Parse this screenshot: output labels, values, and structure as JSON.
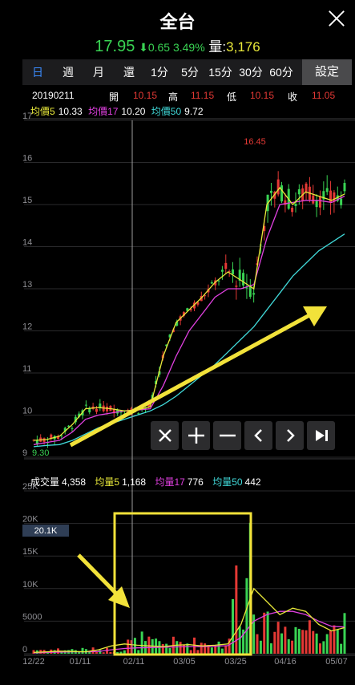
{
  "header": {
    "title": "全台"
  },
  "quote": {
    "price": "17.95",
    "change": "0.65 3.49%",
    "volume_label": "量:",
    "volume": "3,176"
  },
  "tabs": [
    {
      "label": "日",
      "active": true
    },
    {
      "label": "週"
    },
    {
      "label": "月"
    },
    {
      "label": "還"
    },
    {
      "label": "1分"
    },
    {
      "label": "5分"
    },
    {
      "label": "15分"
    },
    {
      "label": "30分"
    },
    {
      "label": "60分"
    }
  ],
  "settings_label": "設定",
  "ohlc": {
    "date": "20190211",
    "open_label": "開",
    "open": "10.15",
    "high_label": "高",
    "high": "11.15",
    "low_label": "低",
    "low": "10.15",
    "close_label": "收",
    "close": "11.05"
  },
  "ma": {
    "ma5_label": "均價5",
    "ma5": "10.33",
    "ma17_label": "均價17",
    "ma17": "10.20",
    "ma50_label": "均價50",
    "ma50": "9.72"
  },
  "price_axis": [
    "17",
    "16",
    "15",
    "14",
    "13",
    "12",
    "11",
    "10",
    "9"
  ],
  "price_marks": {
    "high": "16.45",
    "low": "9.30"
  },
  "volume_info": {
    "label": "成交量",
    "value": "4,358",
    "ma5_label": "均量5",
    "ma5": "1,168",
    "ma17_label": "均量17",
    "ma17": "776",
    "ma50_label": "均量50",
    "ma50": "442"
  },
  "volume_axis": [
    "25K",
    "20K",
    "15K",
    "10K",
    "5000",
    "0"
  ],
  "volume_cursor": "20.1K",
  "date_axis": [
    "12/22",
    "01/11",
    "02/11",
    "03/05",
    "03/25",
    "04/16",
    "05/07"
  ],
  "colors": {
    "up": "#e53935",
    "down": "#39d353",
    "ma5": "#e8e83a",
    "ma17": "#e040e0",
    "ma50": "#40d8d8",
    "accent": "#3b8cff",
    "annotation": "#f2e23a"
  },
  "chart_data": {
    "type": "candlestick",
    "price_ylim": [
      9,
      17
    ],
    "volume_ylim": [
      0,
      25000
    ],
    "x_categories": [
      "12/22",
      "01/11",
      "02/11",
      "03/05",
      "03/25",
      "04/16",
      "05/07"
    ],
    "price_ma5": [
      9.4,
      9.42,
      9.5,
      9.78,
      10.15,
      10.18,
      10.15,
      10.1,
      10.12,
      10.2,
      11.4,
      12.2,
      12.5,
      12.8,
      13.15,
      13.4,
      13.2,
      13.0,
      15.0,
      15.4,
      15.0,
      15.3,
      15.2,
      15.1,
      15.25
    ],
    "price_ma17": [
      9.3,
      9.35,
      9.4,
      9.6,
      9.9,
      10.0,
      10.05,
      10.1,
      10.12,
      10.15,
      10.7,
      11.4,
      12.0,
      12.4,
      12.8,
      13.0,
      13.0,
      13.1,
      14.2,
      15.0,
      15.05,
      15.1,
      15.1,
      15.05,
      15.2
    ],
    "price_ma50": [
      9.25,
      9.28,
      9.3,
      9.4,
      9.55,
      9.7,
      9.8,
      9.9,
      10.0,
      10.1,
      10.25,
      10.45,
      10.7,
      10.95,
      11.2,
      11.5,
      11.8,
      12.1,
      12.5,
      12.9,
      13.3,
      13.6,
      13.9,
      14.1,
      14.3
    ],
    "volume_ma5": [
      200,
      300,
      400,
      350,
      300,
      600,
      1200,
      1500,
      1300,
      1200,
      1100,
      1300,
      1400,
      1200,
      1300,
      1500,
      4500,
      10000,
      8000,
      6000,
      7000,
      6500,
      4500,
      3500,
      4000
    ],
    "volume_ma17": [
      150,
      200,
      250,
      300,
      300,
      350,
      600,
      800,
      900,
      950,
      1000,
      1050,
      1100,
      1100,
      1150,
      1250,
      2500,
      5000,
      6000,
      6500,
      6500,
      6000,
      5000,
      4200,
      4100
    ]
  }
}
